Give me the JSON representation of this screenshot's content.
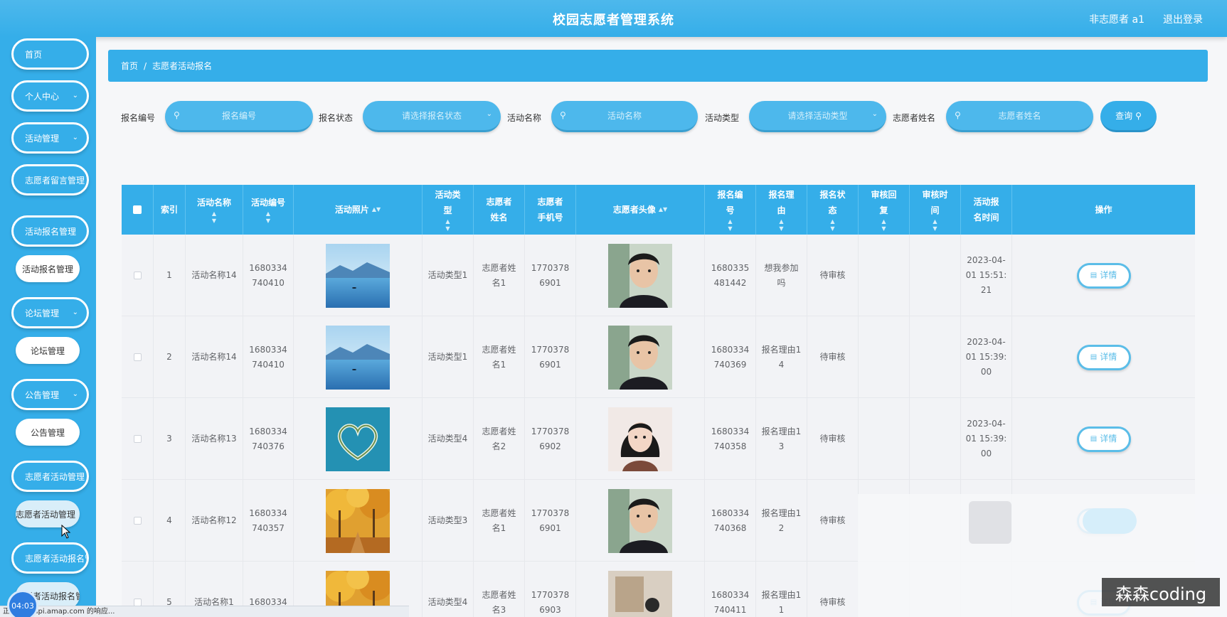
{
  "header": {
    "title": "校园志愿者管理系统",
    "user": "非志愿者 a1",
    "logout": "退出登录"
  },
  "sidebar": {
    "items": [
      {
        "label": "首页"
      },
      {
        "label": "个人中心"
      },
      {
        "label": "活动管理"
      },
      {
        "label": "志愿者留言管理"
      },
      {
        "label": "活动报名管理"
      },
      {
        "label": "活动报名管理"
      },
      {
        "label": "论坛管理"
      },
      {
        "label": "论坛管理"
      },
      {
        "label": "公告管理"
      },
      {
        "label": "公告管理"
      },
      {
        "label": "志愿者活动管理"
      },
      {
        "label": "志愿者活动管理"
      },
      {
        "label": "志愿者活动报名管理"
      },
      {
        "label": "志愿者活动报名管理"
      }
    ]
  },
  "breadcrumb": {
    "home": "首页",
    "sep": "/",
    "current": "志愿者活动报名"
  },
  "search": {
    "f1_label": "报名编号",
    "f1_placeholder": "报名编号",
    "f2_label": "报名状态",
    "f2_placeholder": "请选择报名状态",
    "f3_label": "活动名称",
    "f3_placeholder": "活动名称",
    "f4_label": "活动类型",
    "f4_placeholder": "请选择活动类型",
    "f5_label": "志愿者姓名",
    "f5_placeholder": "志愿者姓名",
    "query": "查询"
  },
  "table": {
    "headers": {
      "index": "索引",
      "activity_name": "活动名称",
      "activity_no": "活动编号",
      "activity_photo": "活动照片",
      "activity_type": "活动类型",
      "volunteer_name": "志愿者姓名",
      "volunteer_phone": "志愿者手机号",
      "volunteer_avatar": "志愿者头像",
      "signup_no": "报名编号",
      "signup_reason": "报名理由",
      "signup_status": "报名状态",
      "review_reply": "审核回复",
      "review_time": "审核时间",
      "signup_time": "活动报名时间",
      "action": "操作"
    },
    "detail_label": "详情",
    "rows": [
      {
        "index": "1",
        "activity_name": "活动名称14",
        "activity_no": "1680334740410",
        "photo": "lake",
        "activity_type": "活动类型1",
        "volunteer_name": "志愿者姓名1",
        "phone": "17703786901",
        "avatar": "male",
        "signup_no": "1680335481442",
        "reason": "想我参加吗",
        "status": "待审核",
        "reply": "",
        "review_time": "",
        "signup_time": "2023-04-01 15:51:21"
      },
      {
        "index": "2",
        "activity_name": "活动名称14",
        "activity_no": "1680334740410",
        "photo": "lake",
        "activity_type": "活动类型1",
        "volunteer_name": "志愿者姓名1",
        "phone": "17703786901",
        "avatar": "male",
        "signup_no": "1680334740369",
        "reason": "报名理由14",
        "status": "待审核",
        "reply": "",
        "review_time": "",
        "signup_time": "2023-04-01 15:39:00"
      },
      {
        "index": "3",
        "activity_name": "活动名称13",
        "activity_no": "1680334740376",
        "photo": "heart",
        "activity_type": "活动类型4",
        "volunteer_name": "志愿者姓名2",
        "phone": "17703786902",
        "avatar": "female",
        "signup_no": "1680334740358",
        "reason": "报名理由13",
        "status": "待审核",
        "reply": "",
        "review_time": "",
        "signup_time": "2023-04-01 15:39:00"
      },
      {
        "index": "4",
        "activity_name": "活动名称12",
        "activity_no": "1680334740357",
        "photo": "autumn",
        "activity_type": "活动类型3",
        "volunteer_name": "志愿者姓名1",
        "phone": "17703786901",
        "avatar": "male",
        "signup_no": "1680334740368",
        "reason": "报名理由12",
        "status": "待审核",
        "reply": "",
        "review_time": "",
        "signup_time": ""
      },
      {
        "index": "5",
        "activity_name": "活动名称1",
        "activity_no": "1680334",
        "photo": "autumn",
        "activity_type": "活动类型4",
        "volunteer_name": "志愿者姓名3",
        "phone": "17703786903",
        "avatar": "photo",
        "signup_no": "1680334740411",
        "reason": "报名理由11",
        "status": "待审核",
        "reply": "",
        "review_time": "",
        "signup_time": ""
      }
    ]
  },
  "watermark": "森森coding",
  "statusbar": "正... webapi.amap.com 的响应...",
  "timer": "04:03",
  "colors": {
    "primary": "#35aee9",
    "light": "#4db8ec",
    "row_bg": "#f2f3f6"
  }
}
